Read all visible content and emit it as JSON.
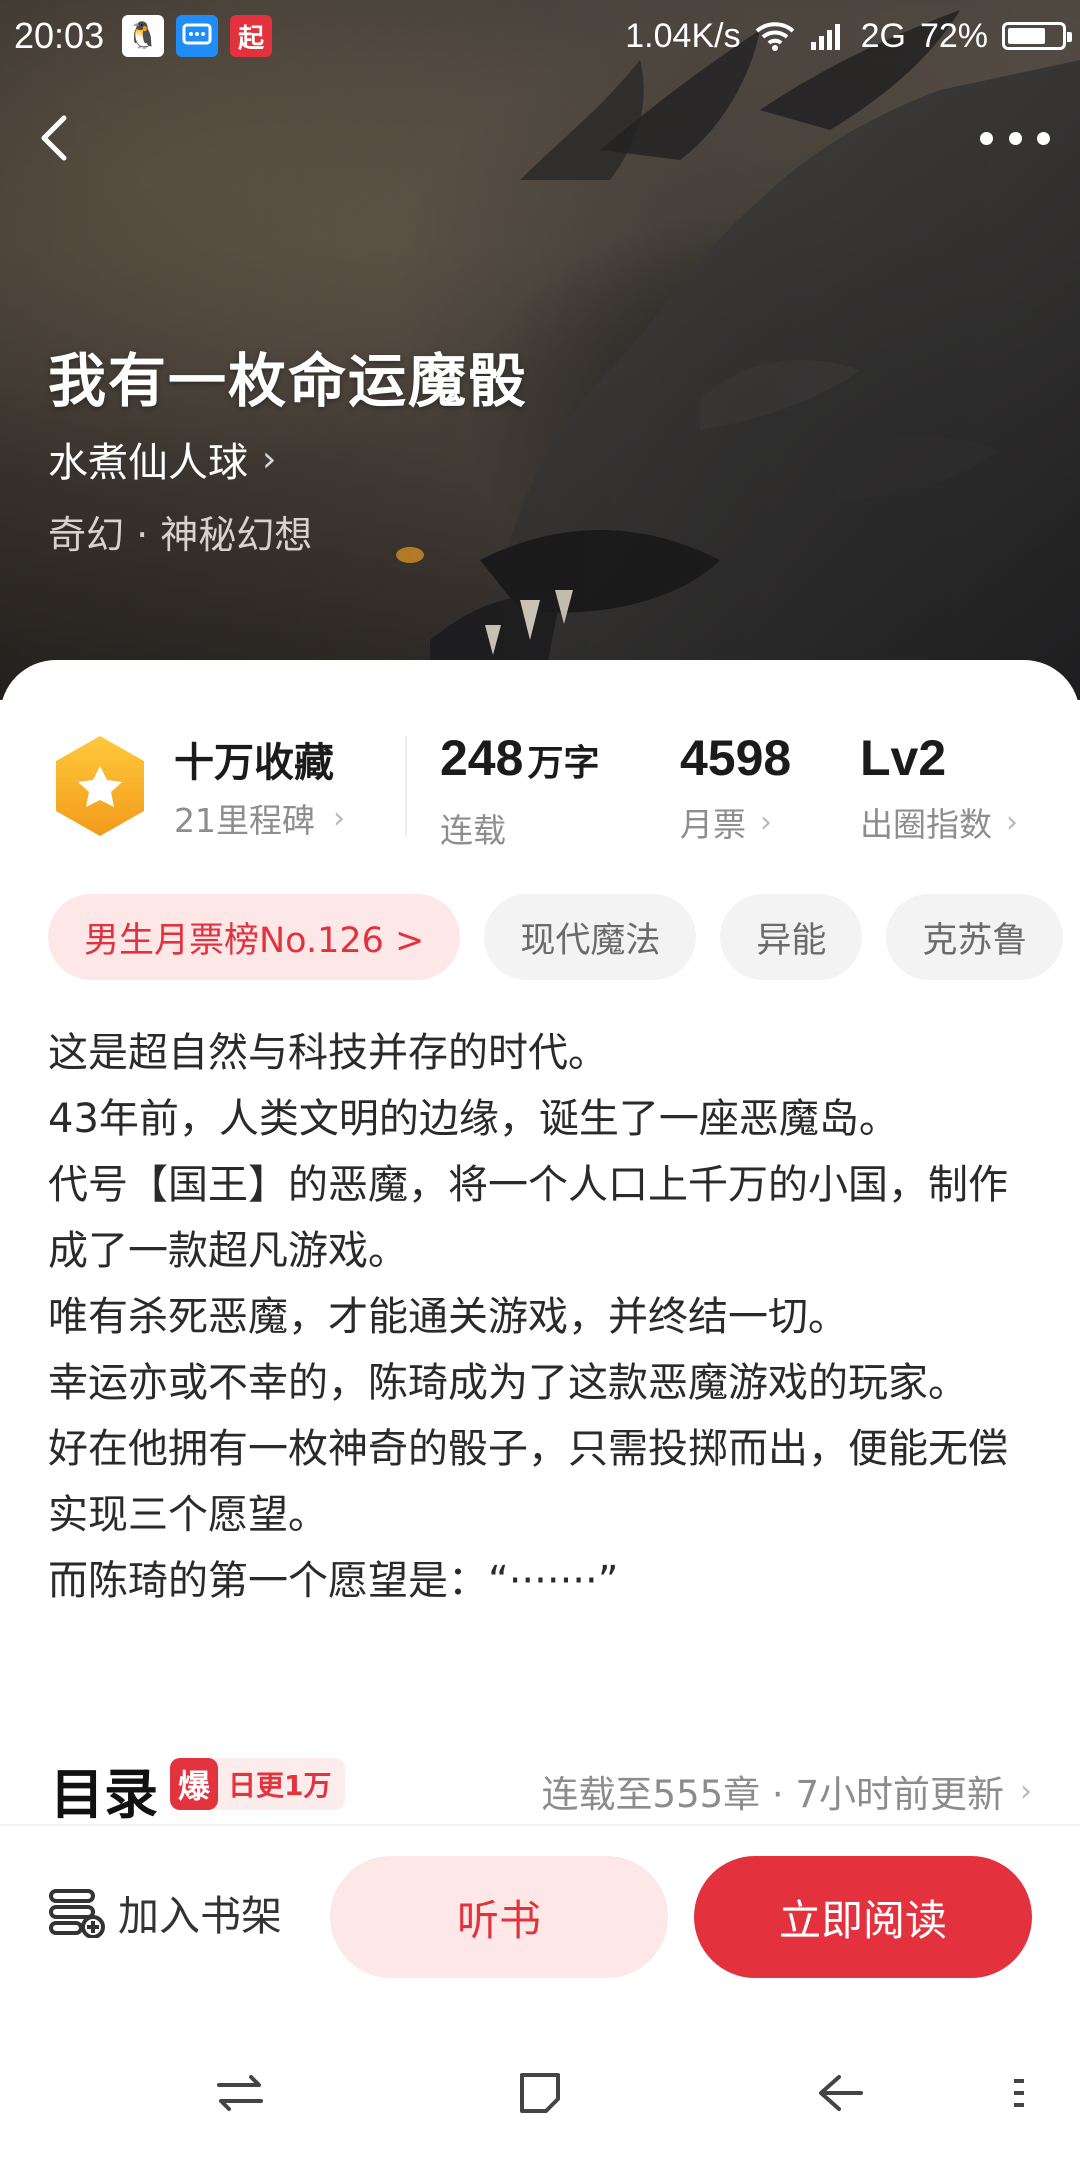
{
  "status_bar": {
    "time": "20:03",
    "apps": [
      {
        "icon": "qq-icon",
        "glyph": "🐧",
        "bg": "#ffffff"
      },
      {
        "icon": "message-icon",
        "glyph": "💬",
        "bg": "#1f8df5"
      },
      {
        "icon": "qidian-icon",
        "glyph": "起",
        "bg": "#e3313e"
      }
    ],
    "speed": "1.04K/s",
    "network": "2G",
    "battery": "72%",
    "battery_level": 0.72
  },
  "book": {
    "title": "我有一枚命运魔骰",
    "author": "水煮仙人球",
    "genre": "奇幻 · 神秘幻想"
  },
  "stats": {
    "collection_label": "十万收藏",
    "milestones": "21里程碑",
    "word_count": "248",
    "word_unit": "万字",
    "word_status": "连载",
    "monthly_tickets": "4598",
    "monthly_tickets_label": "月票",
    "level": "Lv2",
    "level_label": "出圈指数"
  },
  "tags": [
    "男生月票榜No.126 >",
    "现代魔法",
    "异能",
    "克苏鲁"
  ],
  "synopsis": [
    "这是超自然与科技并存的时代。",
    "43年前，人类文明的边缘，诞生了一座恶魔岛。",
    "代号【国王】的恶魔，将一个人口上千万的小国，制作成了一款超凡游戏。",
    "唯有杀死恶魔，才能通关游戏，并终结一切。",
    "幸运亦或不幸的，陈琦成为了这款恶魔游戏的玩家。",
    "好在他拥有一枚神奇的骰子，只需投掷而出，便能无偿实现三个愿望。",
    "而陈琦的第一个愿望是：“·······”"
  ],
  "toc": {
    "title": "目录",
    "hot_badge": "爆",
    "hot_text": "日更1万",
    "update": "连载至555章 · 7小时前更新"
  },
  "actions": {
    "shelf": "加入书架",
    "listen": "听书",
    "read": "立即阅读"
  },
  "colors": {
    "accent": "#e3313e",
    "accent_light": "#fde7e7",
    "badge_gold": "#f5a623"
  }
}
